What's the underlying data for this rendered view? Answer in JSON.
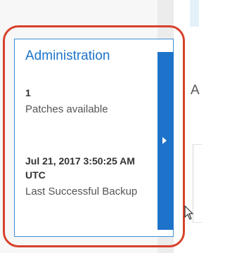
{
  "colors": {
    "accent": "#1d73c9",
    "card_border": "#3a8fd8",
    "highlight": "#d8412c"
  },
  "right_panel": {
    "heading_fragment": "A"
  },
  "card": {
    "title": "Administration",
    "patches": {
      "value": "1",
      "label": "Patches available"
    },
    "backup": {
      "value": "Jul 21, 2017 3:50:25 AM UTC",
      "label": "Last Successful Backup"
    },
    "expand_icon": "chevron-right-icon"
  },
  "cursor_icon": "mouse-pointer-icon"
}
